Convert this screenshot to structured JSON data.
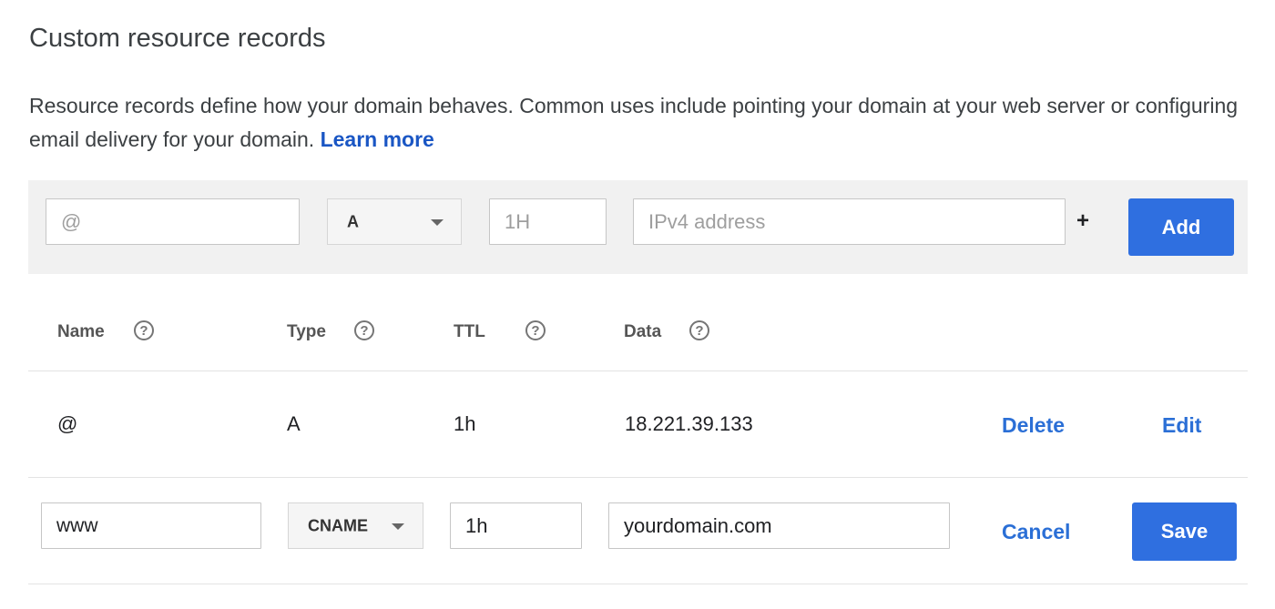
{
  "section": {
    "title": "Custom resource records",
    "description": "Resource records define how your domain behaves. Common uses include pointing your domain at your web server or configuring email delivery for your domain.",
    "learn_more": "Learn more"
  },
  "add_row": {
    "name_placeholder": "@",
    "type_value": "A",
    "ttl_placeholder": "1H",
    "data_placeholder": "IPv4 address",
    "plus": "+",
    "add_label": "Add"
  },
  "table": {
    "headers": {
      "name": "Name",
      "type": "Type",
      "ttl": "TTL",
      "data": "Data"
    },
    "help_glyph": "?",
    "rows": [
      {
        "name": "@",
        "type": "A",
        "ttl": "1h",
        "data": "18.221.39.133",
        "delete_label": "Delete",
        "edit_label": "Edit"
      }
    ],
    "edit_row": {
      "name_value": "www",
      "type_value": "CNAME",
      "ttl_value": "1h",
      "data_value": "yourdomain.com",
      "cancel_label": "Cancel",
      "save_label": "Save"
    }
  },
  "colors": {
    "accent": "#2f6fe0",
    "link": "#1a56c4",
    "add_bar_bg": "#f1f1f1"
  }
}
